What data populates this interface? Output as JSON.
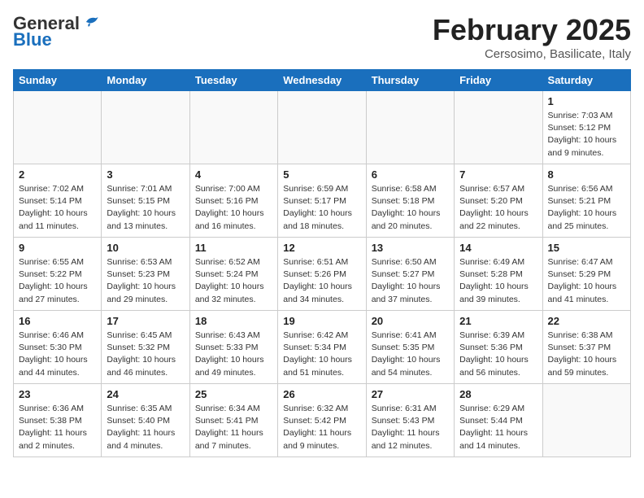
{
  "header": {
    "logo_general": "General",
    "logo_blue": "Blue",
    "month": "February 2025",
    "location": "Cersosimo, Basilicate, Italy"
  },
  "weekdays": [
    "Sunday",
    "Monday",
    "Tuesday",
    "Wednesday",
    "Thursday",
    "Friday",
    "Saturday"
  ],
  "weeks": [
    [
      {
        "day": "",
        "info": ""
      },
      {
        "day": "",
        "info": ""
      },
      {
        "day": "",
        "info": ""
      },
      {
        "day": "",
        "info": ""
      },
      {
        "day": "",
        "info": ""
      },
      {
        "day": "",
        "info": ""
      },
      {
        "day": "1",
        "info": "Sunrise: 7:03 AM\nSunset: 5:12 PM\nDaylight: 10 hours\nand 9 minutes."
      }
    ],
    [
      {
        "day": "2",
        "info": "Sunrise: 7:02 AM\nSunset: 5:14 PM\nDaylight: 10 hours\nand 11 minutes."
      },
      {
        "day": "3",
        "info": "Sunrise: 7:01 AM\nSunset: 5:15 PM\nDaylight: 10 hours\nand 13 minutes."
      },
      {
        "day": "4",
        "info": "Sunrise: 7:00 AM\nSunset: 5:16 PM\nDaylight: 10 hours\nand 16 minutes."
      },
      {
        "day": "5",
        "info": "Sunrise: 6:59 AM\nSunset: 5:17 PM\nDaylight: 10 hours\nand 18 minutes."
      },
      {
        "day": "6",
        "info": "Sunrise: 6:58 AM\nSunset: 5:18 PM\nDaylight: 10 hours\nand 20 minutes."
      },
      {
        "day": "7",
        "info": "Sunrise: 6:57 AM\nSunset: 5:20 PM\nDaylight: 10 hours\nand 22 minutes."
      },
      {
        "day": "8",
        "info": "Sunrise: 6:56 AM\nSunset: 5:21 PM\nDaylight: 10 hours\nand 25 minutes."
      }
    ],
    [
      {
        "day": "9",
        "info": "Sunrise: 6:55 AM\nSunset: 5:22 PM\nDaylight: 10 hours\nand 27 minutes."
      },
      {
        "day": "10",
        "info": "Sunrise: 6:53 AM\nSunset: 5:23 PM\nDaylight: 10 hours\nand 29 minutes."
      },
      {
        "day": "11",
        "info": "Sunrise: 6:52 AM\nSunset: 5:24 PM\nDaylight: 10 hours\nand 32 minutes."
      },
      {
        "day": "12",
        "info": "Sunrise: 6:51 AM\nSunset: 5:26 PM\nDaylight: 10 hours\nand 34 minutes."
      },
      {
        "day": "13",
        "info": "Sunrise: 6:50 AM\nSunset: 5:27 PM\nDaylight: 10 hours\nand 37 minutes."
      },
      {
        "day": "14",
        "info": "Sunrise: 6:49 AM\nSunset: 5:28 PM\nDaylight: 10 hours\nand 39 minutes."
      },
      {
        "day": "15",
        "info": "Sunrise: 6:47 AM\nSunset: 5:29 PM\nDaylight: 10 hours\nand 41 minutes."
      }
    ],
    [
      {
        "day": "16",
        "info": "Sunrise: 6:46 AM\nSunset: 5:30 PM\nDaylight: 10 hours\nand 44 minutes."
      },
      {
        "day": "17",
        "info": "Sunrise: 6:45 AM\nSunset: 5:32 PM\nDaylight: 10 hours\nand 46 minutes."
      },
      {
        "day": "18",
        "info": "Sunrise: 6:43 AM\nSunset: 5:33 PM\nDaylight: 10 hours\nand 49 minutes."
      },
      {
        "day": "19",
        "info": "Sunrise: 6:42 AM\nSunset: 5:34 PM\nDaylight: 10 hours\nand 51 minutes."
      },
      {
        "day": "20",
        "info": "Sunrise: 6:41 AM\nSunset: 5:35 PM\nDaylight: 10 hours\nand 54 minutes."
      },
      {
        "day": "21",
        "info": "Sunrise: 6:39 AM\nSunset: 5:36 PM\nDaylight: 10 hours\nand 56 minutes."
      },
      {
        "day": "22",
        "info": "Sunrise: 6:38 AM\nSunset: 5:37 PM\nDaylight: 10 hours\nand 59 minutes."
      }
    ],
    [
      {
        "day": "23",
        "info": "Sunrise: 6:36 AM\nSunset: 5:38 PM\nDaylight: 11 hours\nand 2 minutes."
      },
      {
        "day": "24",
        "info": "Sunrise: 6:35 AM\nSunset: 5:40 PM\nDaylight: 11 hours\nand 4 minutes."
      },
      {
        "day": "25",
        "info": "Sunrise: 6:34 AM\nSunset: 5:41 PM\nDaylight: 11 hours\nand 7 minutes."
      },
      {
        "day": "26",
        "info": "Sunrise: 6:32 AM\nSunset: 5:42 PM\nDaylight: 11 hours\nand 9 minutes."
      },
      {
        "day": "27",
        "info": "Sunrise: 6:31 AM\nSunset: 5:43 PM\nDaylight: 11 hours\nand 12 minutes."
      },
      {
        "day": "28",
        "info": "Sunrise: 6:29 AM\nSunset: 5:44 PM\nDaylight: 11 hours\nand 14 minutes."
      },
      {
        "day": "",
        "info": ""
      }
    ]
  ]
}
